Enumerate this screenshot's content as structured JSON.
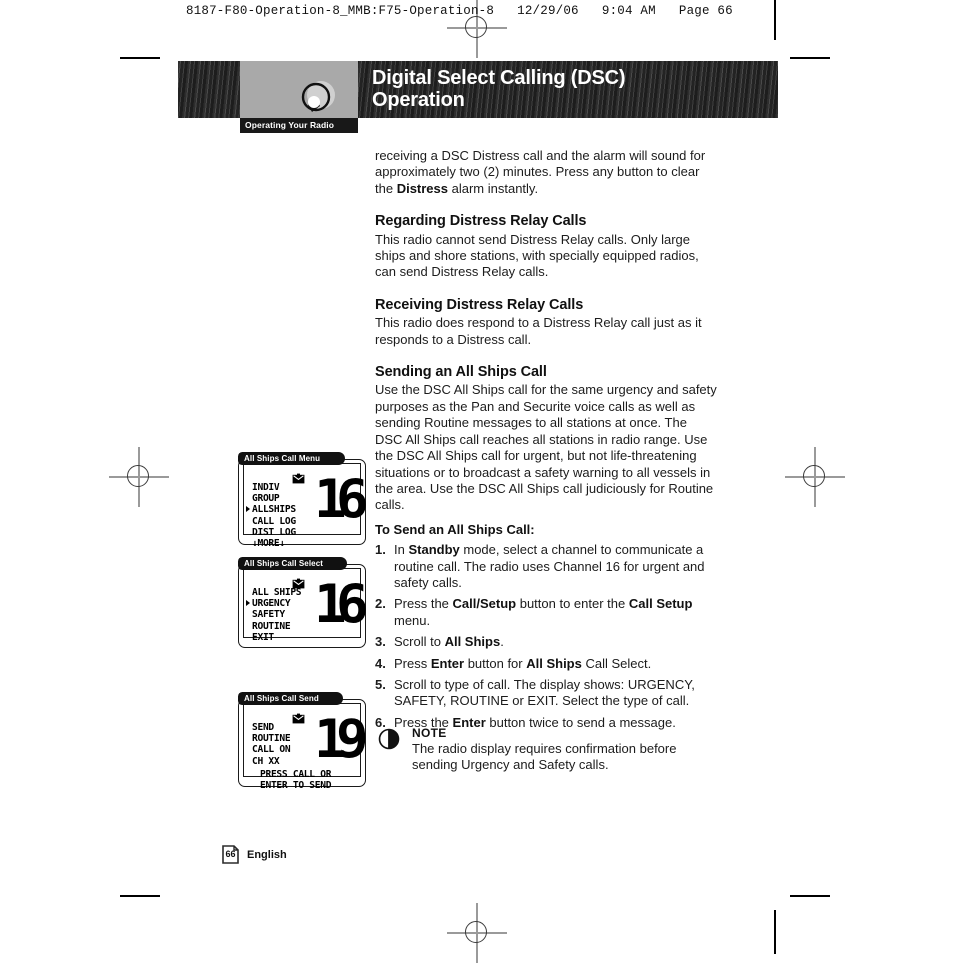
{
  "print_marks": {
    "running_head": "8187-F80-Operation-8_MMB:F75-Operation-8   12/29/06   9:04 AM   Page 66"
  },
  "banner": {
    "title_line1": "Digital Select Calling (DSC)",
    "title_line2": "Operation",
    "tab_label": "Operating Your Radio",
    "icon_name": "radio-speaker-icon"
  },
  "content": {
    "intro_paragraph": "receiving a DSC Distress call and the alarm will sound for approximately two (2) minutes. Press any button to clear the ",
    "intro_bold": "Distress",
    "intro_paragraph_end": " alarm instantly.",
    "section1_heading": "Regarding Distress Relay Calls",
    "section1_text": "This radio cannot send Distress Relay calls. Only large ships and shore stations, with specially equipped radios, can send Distress Relay calls.",
    "section2_heading": "Receiving Distress Relay Calls",
    "section2_text": "This radio does respond to a Distress Relay call just as it responds to a Distress call.",
    "section3_heading": "Sending an All Ships Call",
    "section3_text": "Use the DSC All Ships call for the same urgency and safety purposes as the Pan and Securite voice calls as well as sending Routine messages to all stations at once. The DSC All Ships call reaches all stations in radio range. Use the DSC All Ships call for urgent, but not life-threatening situations or to broadcast a safety warning to all vessels in the area. Use the DSC All Ships call judiciously for Routine calls.",
    "procedure_heading": "To Send an All Ships Call:",
    "steps": [
      {
        "num": "1.",
        "parts": [
          {
            "t": "In ",
            "b": false
          },
          {
            "t": "Standby",
            "b": true
          },
          {
            "t": " mode, select a channel to communicate a routine call. The radio uses Channel 16 for urgent and safety calls.",
            "b": false
          }
        ]
      },
      {
        "num": "2.",
        "parts": [
          {
            "t": "Press the ",
            "b": false
          },
          {
            "t": "Call/Setup",
            "b": true
          },
          {
            "t": " button to enter the ",
            "b": false
          },
          {
            "t": "Call Setup",
            "b": true
          },
          {
            "t": " menu.",
            "b": false
          }
        ]
      },
      {
        "num": "3.",
        "parts": [
          {
            "t": "Scroll to ",
            "b": false
          },
          {
            "t": "All Ships",
            "b": true
          },
          {
            "t": ".",
            "b": false
          }
        ]
      },
      {
        "num": "4.",
        "parts": [
          {
            "t": "Press ",
            "b": false
          },
          {
            "t": "Enter",
            "b": true
          },
          {
            "t": " button for ",
            "b": false
          },
          {
            "t": "All Ships",
            "b": true
          },
          {
            "t": " Call Select.",
            "b": false
          }
        ]
      },
      {
        "num": "5.",
        "parts": [
          {
            "t": "Scroll to type of call. The display shows: URGENCY, SAFETY, ROUTINE or EXIT. Select the type of call.",
            "b": false
          }
        ]
      },
      {
        "num": "6.",
        "parts": [
          {
            "t": "Press the ",
            "b": false
          },
          {
            "t": "Enter",
            "b": true
          },
          {
            "t": " button twice to send a message.",
            "b": false
          }
        ]
      }
    ]
  },
  "note": {
    "icon_name": "note-circle-icon",
    "title": "NOTE",
    "text": "The radio display requires confirmation before sending Urgency and Safety calls."
  },
  "figures": [
    {
      "tab_label": "All Ships Call Menu",
      "menu_rows": [
        {
          "text": "INDIV",
          "selected": false
        },
        {
          "text": "GROUP",
          "selected": false
        },
        {
          "text": "ALLSHIPS",
          "selected": true
        },
        {
          "text": "CALL LOG",
          "selected": false
        },
        {
          "text": "DIST LOG",
          "selected": false
        },
        {
          "text": "↓MORE↓",
          "selected": false
        }
      ],
      "footer_lines": [],
      "channel": "16",
      "mail_icon": "envelope-icon"
    },
    {
      "tab_label": "All Ships Call Select",
      "menu_rows": [
        {
          "text": "ALL SHIPS",
          "selected": false
        },
        {
          "text": "URGENCY",
          "selected": true
        },
        {
          "text": "SAFETY",
          "selected": false
        },
        {
          "text": "ROUTINE",
          "selected": false
        },
        {
          "text": "EXIT",
          "selected": false
        }
      ],
      "footer_lines": [],
      "channel": "16",
      "mail_icon": "envelope-icon"
    },
    {
      "tab_label": "All Ships Call Send",
      "menu_rows": [
        {
          "text": "SEND",
          "selected": false
        },
        {
          "text": "ROUTINE",
          "selected": false
        },
        {
          "text": "CALL ON",
          "selected": false
        },
        {
          "text": "CH XX",
          "selected": false
        }
      ],
      "footer_lines": [
        "PRESS CALL OR",
        "ENTER TO SEND"
      ],
      "channel": "19",
      "mail_icon": "envelope-icon"
    }
  ],
  "footer": {
    "page_number": "66",
    "language": "English"
  }
}
